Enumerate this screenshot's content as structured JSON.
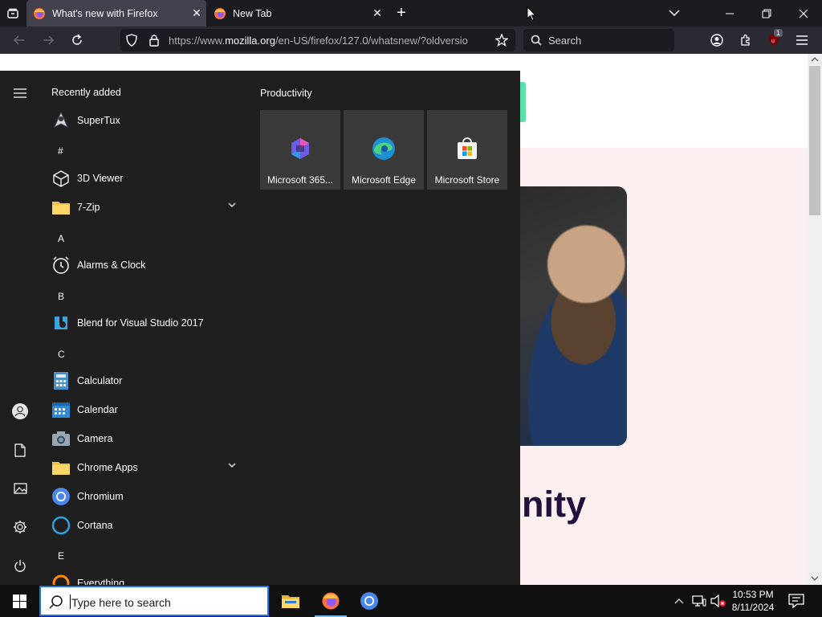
{
  "browser": {
    "tabs": [
      {
        "title": "What's new with Firefox",
        "active": true
      },
      {
        "title": "New Tab",
        "active": false
      }
    ],
    "url_prefix": "https://www.",
    "url_host": "mozilla.org",
    "url_path": "/en-US/firefox/127.0/whatsnew/?oldversio",
    "search_placeholder": "Search",
    "extension_badge": "1"
  },
  "page": {
    "heading_fragment": "nity"
  },
  "start_menu": {
    "recent_label": "Recently added",
    "apps": [
      {
        "name": "SuperTux",
        "icon": "supertux-icon"
      },
      {
        "letter": "#"
      },
      {
        "name": "3D Viewer",
        "icon": "cube-icon"
      },
      {
        "name": "7-Zip",
        "icon": "folder-icon",
        "expandable": true
      },
      {
        "letter": "A"
      },
      {
        "name": "Alarms & Clock",
        "icon": "clock-icon"
      },
      {
        "letter": "B"
      },
      {
        "name": "Blend for Visual Studio 2017",
        "icon": "blend-icon"
      },
      {
        "letter": "C"
      },
      {
        "name": "Calculator",
        "icon": "calculator-icon"
      },
      {
        "name": "Calendar",
        "icon": "calendar-icon"
      },
      {
        "name": "Camera",
        "icon": "camera-icon"
      },
      {
        "name": "Chrome Apps",
        "icon": "folder-icon",
        "expandable": true
      },
      {
        "name": "Chromium",
        "icon": "chromium-icon"
      },
      {
        "name": "Cortana",
        "icon": "cortana-icon"
      },
      {
        "letter": "E"
      },
      {
        "name": "Everything",
        "icon": "everything-icon"
      }
    ],
    "tile_group": "Productivity",
    "tiles": [
      {
        "name": "Microsoft 365...",
        "icon": "m365-icon"
      },
      {
        "name": "Microsoft Edge",
        "icon": "edge-icon"
      },
      {
        "name": "Microsoft Store",
        "icon": "store-icon"
      }
    ]
  },
  "taskbar": {
    "search_placeholder": "Type here to search",
    "time": "10:53 PM",
    "date": "8/11/2024"
  }
}
